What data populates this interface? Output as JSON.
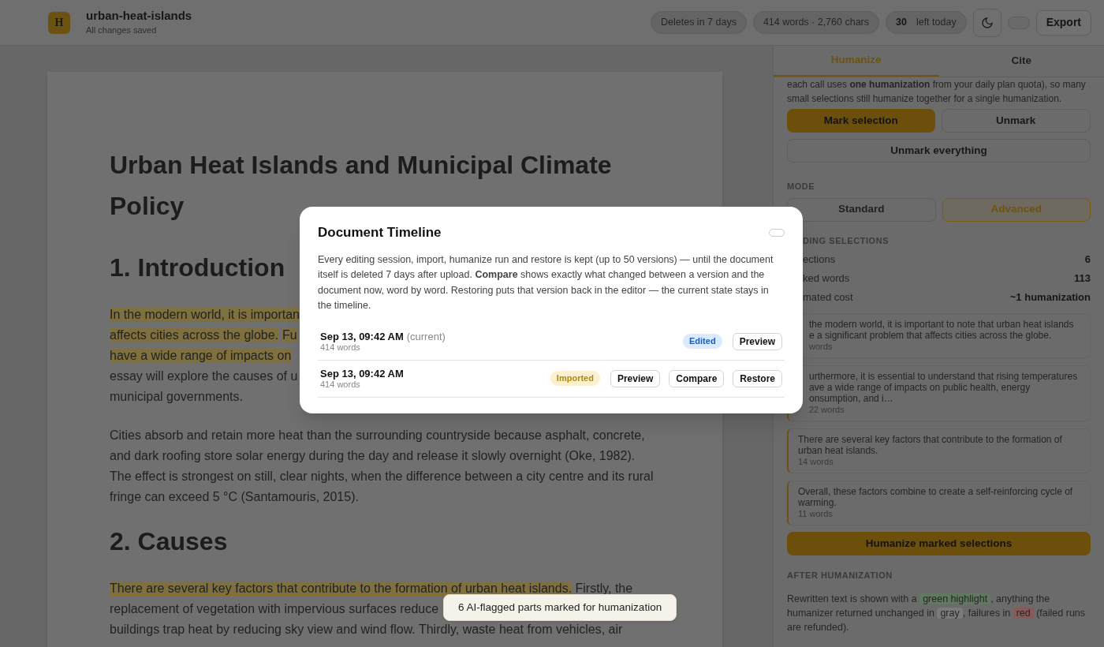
{
  "header": {
    "logo": "H",
    "title": "urban-heat-islands",
    "subtitle": "All changes saved",
    "pills": [
      {
        "text": "Deletes in 7 days"
      },
      {
        "text": "414 words · 2,760 chars"
      }
    ],
    "quota": {
      "count": "30",
      "label": "left today"
    },
    "export": "Export"
  },
  "document": {
    "blocks": [
      {
        "kind": "title",
        "text": "Urban Heat Islands and Municipal Climate Policy"
      },
      {
        "kind": "heading",
        "text": "1. Introduction"
      },
      {
        "kind": "paragraph",
        "lines": [
          [
            {
              "text": "In the modern world, it is importan",
              "marked": true
            }
          ],
          [
            {
              "text": "affects cities across the globe.",
              "marked": true
            },
            {
              "text": "Fu",
              "marked": true
            }
          ],
          [
            {
              "text": "have a wide range of impacts on",
              "marked": true
            }
          ],
          [
            {
              "text": "essay will explore the causes of u",
              "marked": false
            }
          ],
          [
            {
              "text": "municipal governments.",
              "marked": false
            }
          ]
        ]
      },
      {
        "kind": "paragraph",
        "lines": [
          [
            {
              "text": "Cities absorb and retain more heat than the surrounding countryside because asphalt, concrete,",
              "marked": false
            }
          ],
          [
            {
              "text": "and dark roofing store solar energy during the day and release it slowly overnight (Oke, 1982).",
              "marked": false
            }
          ],
          [
            {
              "text": "The effect is strongest on still, clear nights, when the difference between a city centre and its rural",
              "marked": false
            }
          ],
          [
            {
              "text": "fringe can exceed 5 °C (Santamouris, 2015).",
              "marked": false
            }
          ]
        ]
      },
      {
        "kind": "heading",
        "text": "2. Causes"
      },
      {
        "kind": "paragraph",
        "lines": [
          [
            {
              "text": "There are several key factors that contribute to the formation of urban heat islands.",
              "marked": true
            },
            {
              "text": " Firstly, the",
              "marked": false
            }
          ],
          [
            {
              "text": "replacement of vegetation with impervious surfaces reduce",
              "marked": false
            }
          ],
          [
            {
              "text": "buildings trap heat by reducing sky view and wind flow. Thirdly, waste heat from vehicles, air",
              "marked": false
            }
          ]
        ]
      }
    ]
  },
  "sidebar": {
    "tabs": [
      {
        "label": "Humanize",
        "selected": true
      },
      {
        "label": "Cite",
        "selected": false
      }
    ],
    "intro": [
      "each call uses **one humanization** from your daily plan quota), so many",
      "small selections still humanize together for a single humanization."
    ],
    "mark_selection": "Mark selection",
    "unmark": "Unmark",
    "unmark_everything": "Unmark everything",
    "mode_label": "MODE",
    "modes": [
      {
        "label": "Standard",
        "selected": false
      },
      {
        "label": "Advanced",
        "selected": true
      }
    ],
    "pending_label": "DING SELECTIONS",
    "stats": [
      {
        "label": "ections",
        "value": "6"
      },
      {
        "label": "ked words",
        "value": "113"
      },
      {
        "label": "mated cost",
        "value": "~1 humanization"
      }
    ],
    "selections": [
      {
        "lines": [
          "the modern world, it is important to note that urban heat islands",
          "e a significant problem that affects cities across the globe."
        ],
        "words": "words"
      },
      {
        "lines": [
          "urthermore, it is essential to understand that rising temperatures",
          "ave a wide range of impacts on public health, energy",
          "onsumption, and i…"
        ],
        "words": "22 words"
      },
      {
        "lines": [
          "There are several key factors that contribute to the formation of",
          "urban heat islands."
        ],
        "words": "14 words"
      },
      {
        "lines": [
          "Overall, these factors combine to create a self-reinforcing cycle of",
          "warming."
        ],
        "words": "11 words"
      }
    ],
    "humanize_button": "Humanize marked selections",
    "after_label": "AFTER HUMANIZATION",
    "after_text": [
      {
        "kind": "plain",
        "text": "Rewritten text is shown with a "
      },
      {
        "kind": "green",
        "text": "green highlight"
      },
      {
        "kind": "plain",
        "text": ", anything the humanizer returned unchanged in "
      },
      {
        "kind": "gray",
        "text": "gray"
      },
      {
        "kind": "plain",
        "text": ", failures in "
      },
      {
        "kind": "red",
        "text": "red"
      },
      {
        "kind": "plain",
        "text": " (failed runs are refunded)."
      }
    ]
  },
  "modal": {
    "title": "Document Timeline",
    "description": "Every editing session, import, humanize run and restore is kept (up to 50 versions) — until the document itself is deleted 7 days after upload. **Compare** shows exactly what changed between a version and the document now, word by word. Restoring puts that version back in the editor — the current state stays in the timeline.",
    "versions": [
      {
        "time": "Sep 13, 09:42 AM",
        "note": "(current)",
        "words": "414 words",
        "badge": {
          "kind": "edited",
          "text": "Edited"
        },
        "actions": [
          "Preview"
        ]
      },
      {
        "time": "Sep 13, 09:42 AM",
        "words": "414 words",
        "badge": {
          "kind": "imported",
          "text": "Imported"
        },
        "actions": [
          "Preview",
          "Compare",
          "Restore"
        ]
      }
    ]
  },
  "toast": "6 AI-flagged parts marked for humanization"
}
